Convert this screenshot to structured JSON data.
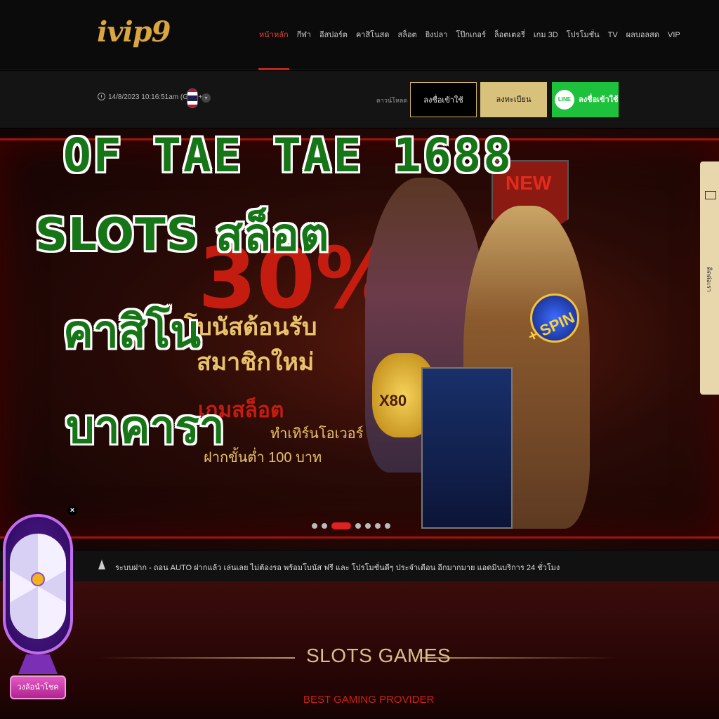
{
  "header": {
    "logo": "ivip9",
    "nav": [
      {
        "label": "หน้าหลัก",
        "active": true
      },
      {
        "label": "กีฬา"
      },
      {
        "label": "อีสปอร์ต"
      },
      {
        "label": "คาสิโนสด"
      },
      {
        "label": "สล็อต"
      },
      {
        "label": "ยิงปลา"
      },
      {
        "label": "โป๊กเกอร์"
      },
      {
        "label": "ล็อตเตอรี่"
      },
      {
        "label": "เกม 3D"
      },
      {
        "label": "โปรโมชั่น"
      },
      {
        "label": "TV"
      },
      {
        "label": "ผลบอลสด"
      },
      {
        "label": "VIP"
      }
    ]
  },
  "subbar": {
    "datetime": "14/8/2023 10:16:51am (GMT+8)",
    "download_label": "ดาวน์โหลด",
    "login_label": "ลงชื่อเข้าใช้",
    "register_label": "ลงทะเบียน",
    "line_badge": "LINE",
    "line_login_label": "ลงชื่อเข้าใช้"
  },
  "banner": {
    "new_badge": "NEW",
    "percent": "30%",
    "line1": "โบนัสต้อนรับ",
    "line2": "สมาชิกใหม่",
    "line3": "เกมสล็อต",
    "line4": "ทำเทิร์นโอเวอร์ 1 เท่า",
    "line5": "ฝากขั้นต่ำ 100 บาท",
    "multiplier": "X80",
    "spin": "+ SPIN",
    "slide_count": 8,
    "active_slide": 3
  },
  "side_tab": {
    "label": "ติดต่อเรา"
  },
  "marquee": {
    "text": "ระบบฝาก - ถอน AUTO ฝากแล้ว เล่นเลย ไม่ต้องรอ พร้อมโบนัส ฟรี และ โปรโมชั่นดีๆ ประจำเดือน อีกมากมาย แอดมินบริการ 24 ชั่วโมง"
  },
  "section": {
    "title": "SLOTS GAMES",
    "subtitle": "BEST GAMING PROVIDER"
  },
  "wheel": {
    "close": "×",
    "button_label": "วงล้อนำโชค"
  },
  "headline": {
    "line1": "OF TAE TAE 1688",
    "line2": "SLOTS สล็อต",
    "line3": "คาสิโน",
    "line4": "บาคารา"
  },
  "colors": {
    "accent_red": "#c0261f",
    "gold": "#d8c17b",
    "line_green": "#1ec13b",
    "headline_green": "#167516"
  }
}
